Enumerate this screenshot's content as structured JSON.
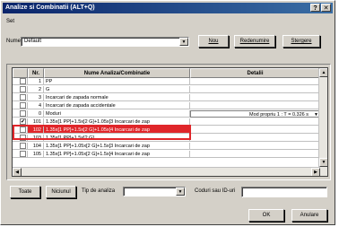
{
  "window": {
    "title": "Analize si Combinatii (ALT+Q)",
    "help_btn": "?",
    "close_btn": "✕"
  },
  "set": {
    "group_label": "Set",
    "name_label": "Nume",
    "name_value": "Default",
    "btn_new": "Nou",
    "btn_rename": "Redenumire",
    "btn_delete": "Stergere"
  },
  "grid": {
    "headers": [
      "",
      "Nr.",
      "Nume Analiza/Combinatie",
      "Detalii"
    ],
    "rows": [
      {
        "checked": false,
        "nr": "1",
        "name": "PP",
        "details": "",
        "red": false
      },
      {
        "checked": false,
        "nr": "2",
        "name": "G",
        "details": "",
        "red": false
      },
      {
        "checked": false,
        "nr": "3",
        "name": "Incarcari de zapada normale",
        "details": "",
        "red": false
      },
      {
        "checked": false,
        "nr": "4",
        "name": "Incarcari de zapada accidentale",
        "details": "",
        "red": false
      },
      {
        "checked": false,
        "nr": "0",
        "name": "Moduri",
        "details": "Mod propriu 1 : T = 0.326 s",
        "red": false
      },
      {
        "checked": true,
        "nr": "101",
        "name": "1.35x[1 PP]+1.5x[2 G]+1.05x[3 Incarcari de zap",
        "details": "",
        "red": false
      },
      {
        "checked": false,
        "nr": "102",
        "name": "1.35x[1 PP]+1.5x[2 G]+1.05x[4 Incarcari de zap",
        "details": "",
        "red": true
      },
      {
        "checked": false,
        "nr": "103",
        "name": "1.35x[1 PP]+1.5x[2 G]",
        "details": "",
        "red": false
      },
      {
        "checked": false,
        "nr": "104",
        "name": "1.35x[1 PP]+1.05x[2 G]+1.5x[3 Incarcari de zap",
        "details": "",
        "red": false
      },
      {
        "checked": false,
        "nr": "105",
        "name": "1.35x[1 PP]+1.05x[2 G]+1.5x[4 Incarcari de zap",
        "details": "",
        "red": false
      }
    ]
  },
  "bottom": {
    "btn_all": "Toate",
    "btn_none": "Niciunul",
    "type_label": "Tip de analiza",
    "codes_label": "Coduri sau ID-uri"
  },
  "footer": {
    "ok": "OK",
    "cancel": "Anulare"
  },
  "colors": {
    "highlight": "#e0262a",
    "title_bar": "#0a246a"
  }
}
